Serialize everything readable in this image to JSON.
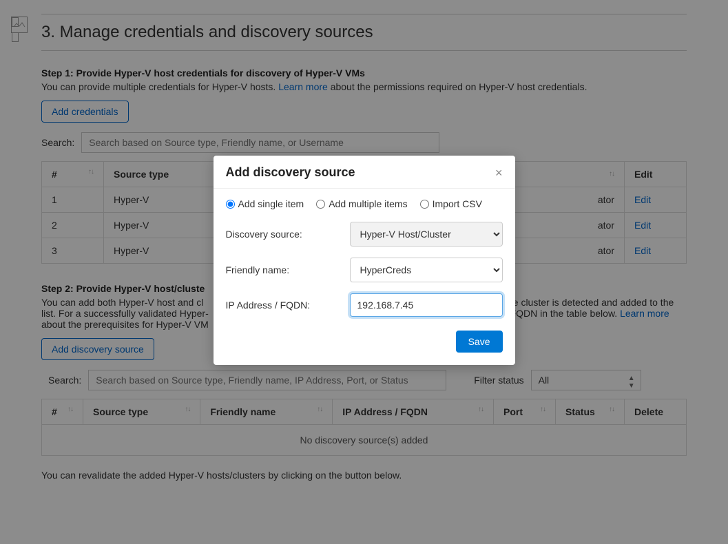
{
  "page": {
    "title": "3. Manage credentials and discovery sources"
  },
  "step1": {
    "title": "Step 1: Provide Hyper-V host credentials for discovery of Hyper-V VMs",
    "desc_before": "You can provide multiple credentials for Hyper-V hosts. ",
    "learn_more": "Learn more",
    "desc_after": " about the permissions required on Hyper-V host credentials.",
    "add_btn": "Add credentials",
    "search_label": "Search:",
    "search_placeholder": "Search based on Source type, Friendly name, or Username",
    "columns": {
      "num": "#",
      "source_type": "Source type",
      "edit": "Edit"
    },
    "rows": [
      {
        "num": "1",
        "source_type": "Hyper-V",
        "user_fragment": "ator",
        "edit": "Edit"
      },
      {
        "num": "2",
        "source_type": "Hyper-V",
        "user_fragment": "ator",
        "edit": "Edit"
      },
      {
        "num": "3",
        "source_type": "Hyper-V",
        "user_fragment": "ator",
        "edit": "Edit"
      }
    ]
  },
  "step2": {
    "title": "Step 2: Provide Hyper-V host/cluste",
    "desc_before": "You can add both Hyper-V host and cl",
    "desc_mid": " the cluster is detected and added to the list. For a successfully validated Hyper-",
    "desc_mid2": " FQDN in the table below. ",
    "learn_more": "Learn more",
    "desc_after": " about the prerequisites for Hyper-V VM",
    "add_btn": "Add discovery source",
    "search_label": "Search:",
    "search_placeholder": "Search based on Source type, Friendly name, IP Address, Port, or Status",
    "filter_label": "Filter status",
    "filter_value": "All",
    "columns": {
      "num": "#",
      "source_type": "Source type",
      "friendly": "Friendly name",
      "ip": "IP Address / FQDN",
      "port": "Port",
      "status": "Status",
      "delete": "Delete"
    },
    "empty": "No discovery source(s) added",
    "revalidate": "You can revalidate the added Hyper-V hosts/clusters by clicking on the button below."
  },
  "modal": {
    "title": "Add discovery source",
    "close": "×",
    "radios": {
      "single": "Add single item",
      "multiple": "Add multiple items",
      "csv": "Import CSV"
    },
    "labels": {
      "source": "Discovery source:",
      "friendly": "Friendly name:",
      "ip": "IP Address / FQDN:"
    },
    "values": {
      "source": "Hyper-V Host/Cluster",
      "friendly": "HyperCreds",
      "ip": "192.168.7.45"
    },
    "save": "Save"
  }
}
